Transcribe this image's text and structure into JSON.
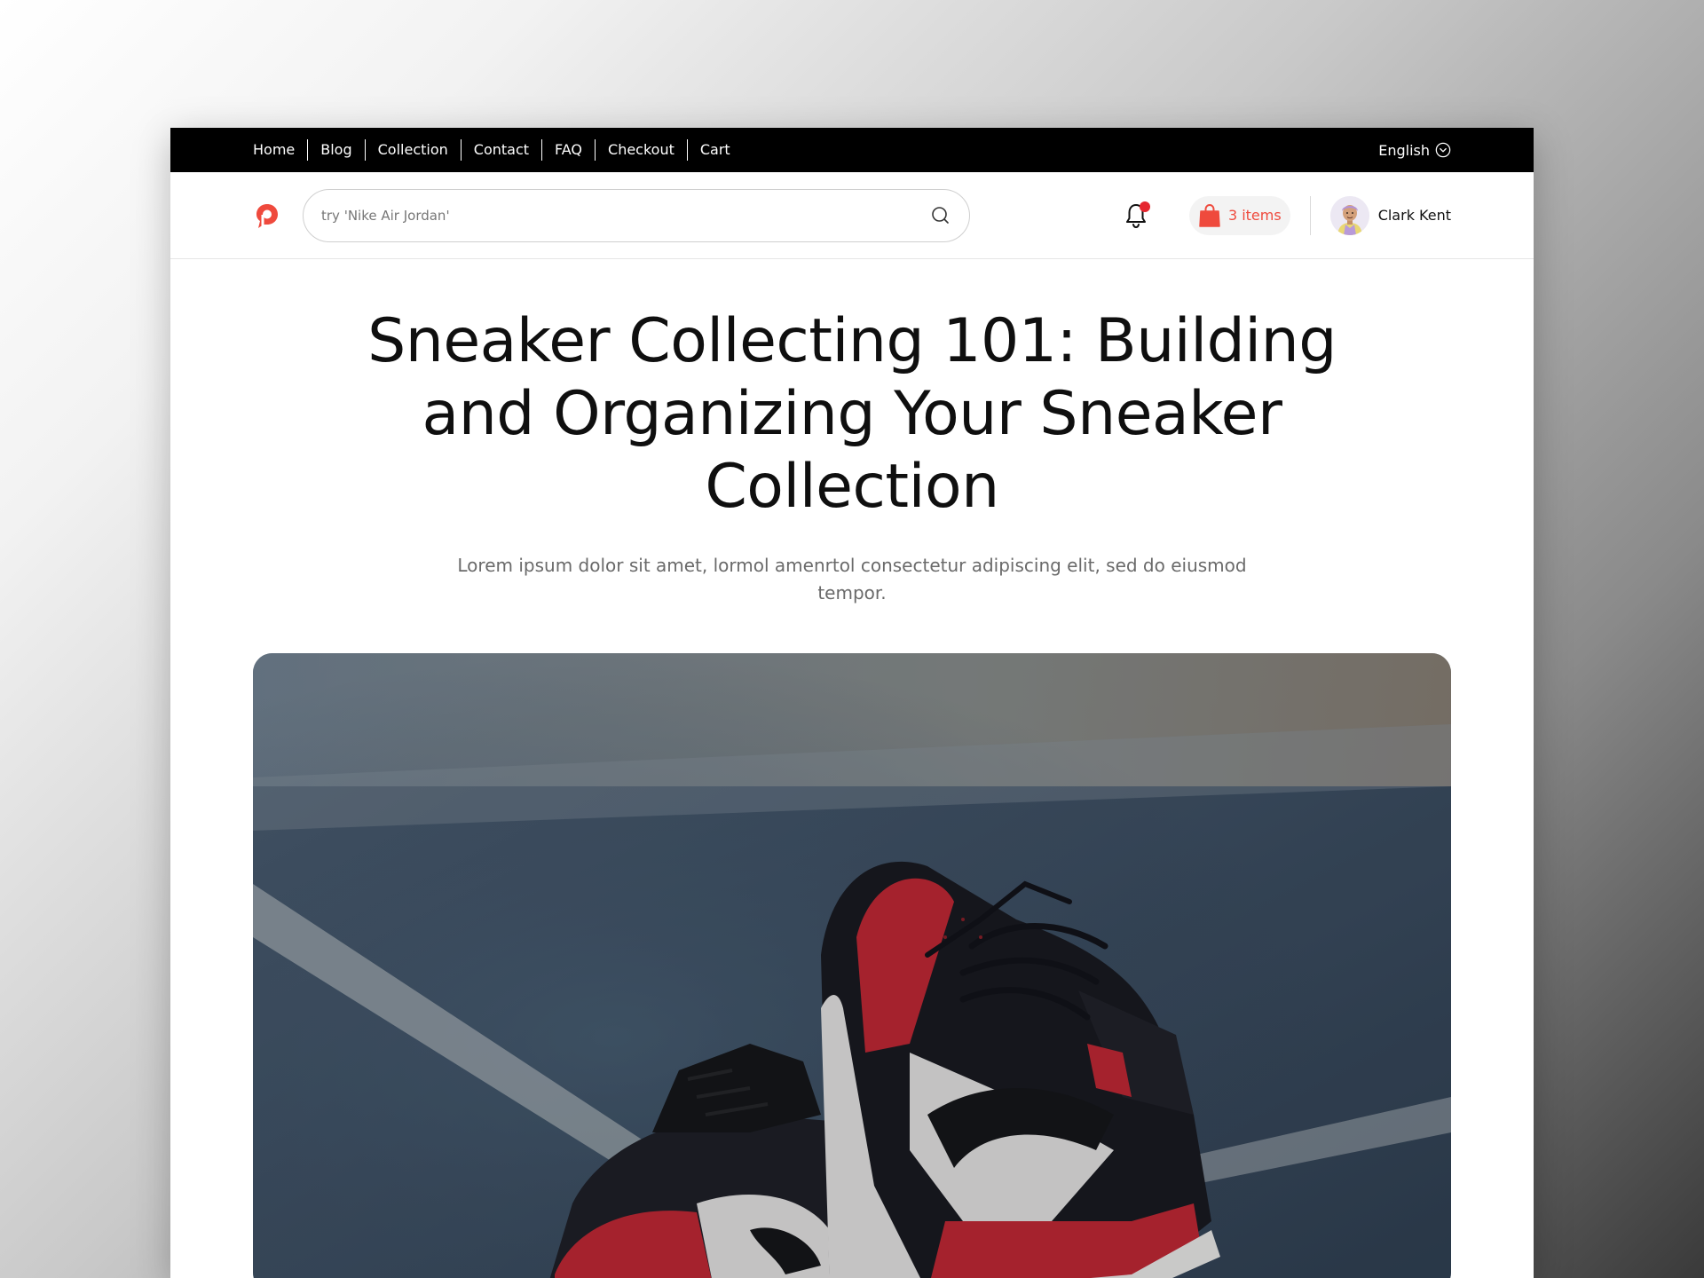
{
  "topnav": {
    "links": [
      "Home",
      "Blog",
      "Collection",
      "Contact",
      "FAQ",
      "Checkout",
      "Cart"
    ],
    "language": "English"
  },
  "header": {
    "search_placeholder": "try 'Nike Air Jordan'",
    "cart_label": "3 items",
    "user_name": "Clark Kent"
  },
  "hero": {
    "title": "Sneaker Collecting 101: Building and Organizing Your Sneaker Collection",
    "subtitle": "Lorem ipsum dolor sit amet, lormol amenrtol consectetur adipiscing elit, sed do eiusmod tempor."
  },
  "colors": {
    "accent": "#ef4a3d",
    "notification": "#e5262f",
    "topbar": "#000000"
  },
  "icons": {
    "logo": "brand-logo-icon",
    "search": "search-icon",
    "bell": "bell-icon",
    "bag": "shopping-bag-icon",
    "language": "chevron-down-circle-icon"
  }
}
